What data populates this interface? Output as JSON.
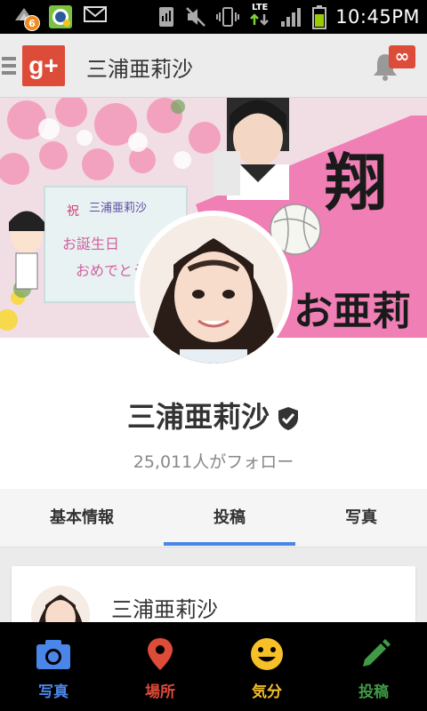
{
  "status_bar": {
    "time": "10:45PM",
    "notification_count": "6",
    "network": "LTE",
    "icons": [
      "chrome-icon",
      "camera-app-icon",
      "mail-icon",
      "signal-icon",
      "mute-icon",
      "vibrate-icon",
      "lte-icon",
      "signal-bars-icon",
      "battery-icon"
    ]
  },
  "app_bar": {
    "logo": "g+",
    "title": "三浦亜莉沙",
    "notification_badge": "∞"
  },
  "profile": {
    "name": "三浦亜莉沙",
    "followers": "25,011人がフォロー"
  },
  "tabs": [
    {
      "label": "基本情報",
      "active": false
    },
    {
      "label": "投稿",
      "active": true
    },
    {
      "label": "写真",
      "active": false
    }
  ],
  "post": {
    "author": "三浦亜莉沙"
  },
  "bottom_nav": [
    {
      "label": "写真",
      "icon": "camera-icon",
      "color": "#4a86e8"
    },
    {
      "label": "場所",
      "icon": "location-pin-icon",
      "color": "#dd4b39"
    },
    {
      "label": "気分",
      "icon": "smiley-icon",
      "color": "#f6c026"
    },
    {
      "label": "投稿",
      "icon": "pencil-icon",
      "color": "#3f9b46"
    }
  ],
  "colors": {
    "accent_blue": "#4a86e8",
    "gplus_red": "#dd4b39"
  }
}
